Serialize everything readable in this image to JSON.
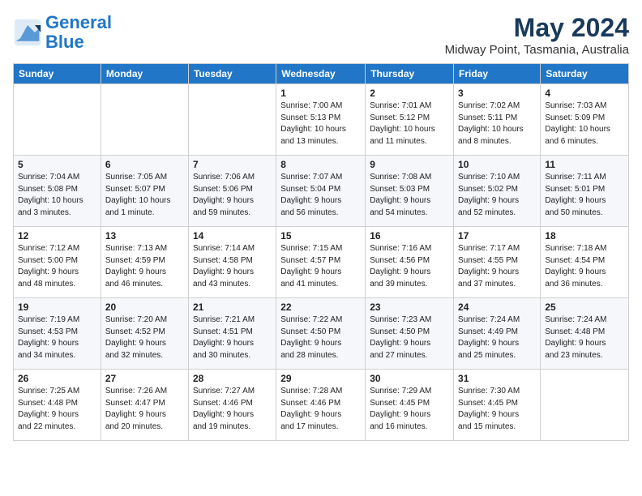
{
  "header": {
    "logo_line1": "General",
    "logo_line2": "Blue",
    "month": "May 2024",
    "location": "Midway Point, Tasmania, Australia"
  },
  "weekdays": [
    "Sunday",
    "Monday",
    "Tuesday",
    "Wednesday",
    "Thursday",
    "Friday",
    "Saturday"
  ],
  "weeks": [
    [
      {
        "day": "",
        "info": ""
      },
      {
        "day": "",
        "info": ""
      },
      {
        "day": "",
        "info": ""
      },
      {
        "day": "1",
        "info": "Sunrise: 7:00 AM\nSunset: 5:13 PM\nDaylight: 10 hours\nand 13 minutes."
      },
      {
        "day": "2",
        "info": "Sunrise: 7:01 AM\nSunset: 5:12 PM\nDaylight: 10 hours\nand 11 minutes."
      },
      {
        "day": "3",
        "info": "Sunrise: 7:02 AM\nSunset: 5:11 PM\nDaylight: 10 hours\nand 8 minutes."
      },
      {
        "day": "4",
        "info": "Sunrise: 7:03 AM\nSunset: 5:09 PM\nDaylight: 10 hours\nand 6 minutes."
      }
    ],
    [
      {
        "day": "5",
        "info": "Sunrise: 7:04 AM\nSunset: 5:08 PM\nDaylight: 10 hours\nand 3 minutes."
      },
      {
        "day": "6",
        "info": "Sunrise: 7:05 AM\nSunset: 5:07 PM\nDaylight: 10 hours\nand 1 minute."
      },
      {
        "day": "7",
        "info": "Sunrise: 7:06 AM\nSunset: 5:06 PM\nDaylight: 9 hours\nand 59 minutes."
      },
      {
        "day": "8",
        "info": "Sunrise: 7:07 AM\nSunset: 5:04 PM\nDaylight: 9 hours\nand 56 minutes."
      },
      {
        "day": "9",
        "info": "Sunrise: 7:08 AM\nSunset: 5:03 PM\nDaylight: 9 hours\nand 54 minutes."
      },
      {
        "day": "10",
        "info": "Sunrise: 7:10 AM\nSunset: 5:02 PM\nDaylight: 9 hours\nand 52 minutes."
      },
      {
        "day": "11",
        "info": "Sunrise: 7:11 AM\nSunset: 5:01 PM\nDaylight: 9 hours\nand 50 minutes."
      }
    ],
    [
      {
        "day": "12",
        "info": "Sunrise: 7:12 AM\nSunset: 5:00 PM\nDaylight: 9 hours\nand 48 minutes."
      },
      {
        "day": "13",
        "info": "Sunrise: 7:13 AM\nSunset: 4:59 PM\nDaylight: 9 hours\nand 46 minutes."
      },
      {
        "day": "14",
        "info": "Sunrise: 7:14 AM\nSunset: 4:58 PM\nDaylight: 9 hours\nand 43 minutes."
      },
      {
        "day": "15",
        "info": "Sunrise: 7:15 AM\nSunset: 4:57 PM\nDaylight: 9 hours\nand 41 minutes."
      },
      {
        "day": "16",
        "info": "Sunrise: 7:16 AM\nSunset: 4:56 PM\nDaylight: 9 hours\nand 39 minutes."
      },
      {
        "day": "17",
        "info": "Sunrise: 7:17 AM\nSunset: 4:55 PM\nDaylight: 9 hours\nand 37 minutes."
      },
      {
        "day": "18",
        "info": "Sunrise: 7:18 AM\nSunset: 4:54 PM\nDaylight: 9 hours\nand 36 minutes."
      }
    ],
    [
      {
        "day": "19",
        "info": "Sunrise: 7:19 AM\nSunset: 4:53 PM\nDaylight: 9 hours\nand 34 minutes."
      },
      {
        "day": "20",
        "info": "Sunrise: 7:20 AM\nSunset: 4:52 PM\nDaylight: 9 hours\nand 32 minutes."
      },
      {
        "day": "21",
        "info": "Sunrise: 7:21 AM\nSunset: 4:51 PM\nDaylight: 9 hours\nand 30 minutes."
      },
      {
        "day": "22",
        "info": "Sunrise: 7:22 AM\nSunset: 4:50 PM\nDaylight: 9 hours\nand 28 minutes."
      },
      {
        "day": "23",
        "info": "Sunrise: 7:23 AM\nSunset: 4:50 PM\nDaylight: 9 hours\nand 27 minutes."
      },
      {
        "day": "24",
        "info": "Sunrise: 7:24 AM\nSunset: 4:49 PM\nDaylight: 9 hours\nand 25 minutes."
      },
      {
        "day": "25",
        "info": "Sunrise: 7:24 AM\nSunset: 4:48 PM\nDaylight: 9 hours\nand 23 minutes."
      }
    ],
    [
      {
        "day": "26",
        "info": "Sunrise: 7:25 AM\nSunset: 4:48 PM\nDaylight: 9 hours\nand 22 minutes."
      },
      {
        "day": "27",
        "info": "Sunrise: 7:26 AM\nSunset: 4:47 PM\nDaylight: 9 hours\nand 20 minutes."
      },
      {
        "day": "28",
        "info": "Sunrise: 7:27 AM\nSunset: 4:46 PM\nDaylight: 9 hours\nand 19 minutes."
      },
      {
        "day": "29",
        "info": "Sunrise: 7:28 AM\nSunset: 4:46 PM\nDaylight: 9 hours\nand 17 minutes."
      },
      {
        "day": "30",
        "info": "Sunrise: 7:29 AM\nSunset: 4:45 PM\nDaylight: 9 hours\nand 16 minutes."
      },
      {
        "day": "31",
        "info": "Sunrise: 7:30 AM\nSunset: 4:45 PM\nDaylight: 9 hours\nand 15 minutes."
      },
      {
        "day": "",
        "info": ""
      }
    ]
  ]
}
